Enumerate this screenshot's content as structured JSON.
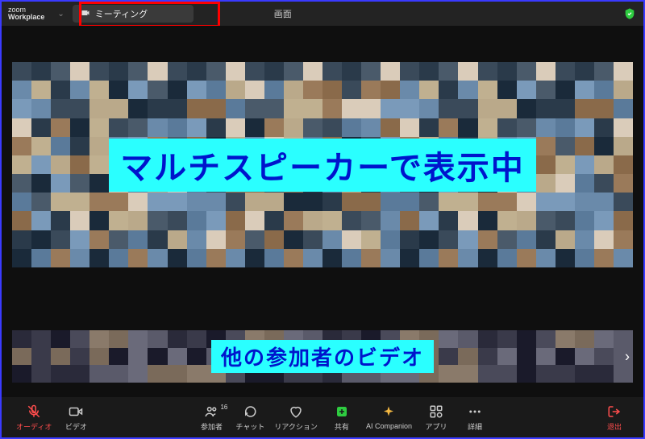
{
  "header": {
    "brand_top": "zoom",
    "brand_bottom": "Workplace",
    "meeting_label": "ミーティング",
    "view_label": "画面"
  },
  "main": {
    "speaker_overlay": "マルチスピーカーで表示中",
    "gallery_overlay": "他の参加者のビデオ"
  },
  "toolbar": {
    "audio": "オーディオ",
    "video": "ビデオ",
    "participants": "参加者",
    "participants_count": "16",
    "chat": "チャット",
    "reactions": "リアクション",
    "share": "共有",
    "ai": "AI Companion",
    "apps": "アプリ",
    "more": "詳細",
    "leave": "退出"
  },
  "icons": {
    "meeting": "video-icon",
    "shield": "shield-icon"
  },
  "colors": {
    "overlay_bg": "#2affff",
    "overlay_fg": "#0015cc",
    "highlight_box": "#ff0000"
  }
}
